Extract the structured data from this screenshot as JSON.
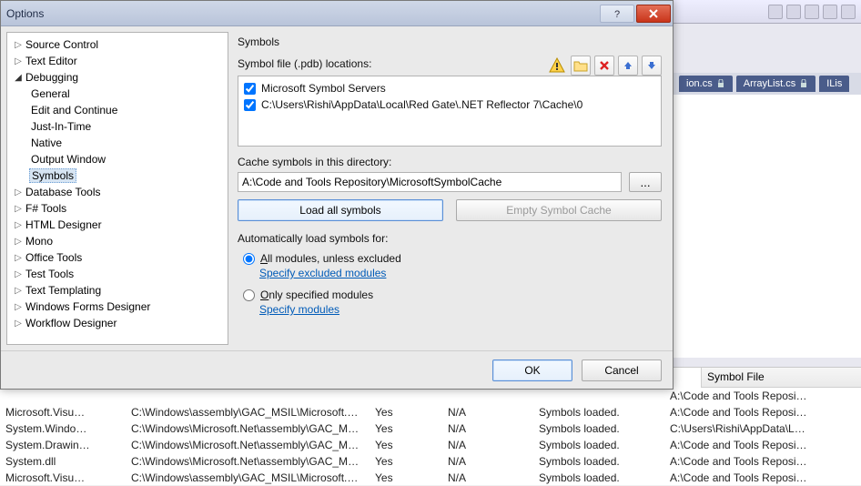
{
  "dialog": {
    "title": "Options",
    "tree": {
      "items": [
        {
          "kind": "node",
          "label": "Source Control",
          "expanded": false
        },
        {
          "kind": "node",
          "label": "Text Editor",
          "expanded": false
        },
        {
          "kind": "node",
          "label": "Debugging",
          "expanded": true
        },
        {
          "kind": "leaf",
          "label": "General"
        },
        {
          "kind": "leaf",
          "label": "Edit and Continue"
        },
        {
          "kind": "leaf",
          "label": "Just-In-Time"
        },
        {
          "kind": "leaf",
          "label": "Native"
        },
        {
          "kind": "leaf",
          "label": "Output Window"
        },
        {
          "kind": "leaf",
          "label": "Symbols",
          "selected": true
        },
        {
          "kind": "node",
          "label": "Database Tools",
          "expanded": false
        },
        {
          "kind": "node",
          "label": "F# Tools",
          "expanded": false
        },
        {
          "kind": "node",
          "label": "HTML Designer",
          "expanded": false
        },
        {
          "kind": "node",
          "label": "Mono",
          "expanded": false
        },
        {
          "kind": "node",
          "label": "Office Tools",
          "expanded": false
        },
        {
          "kind": "node",
          "label": "Test Tools",
          "expanded": false
        },
        {
          "kind": "node",
          "label": "Text Templating",
          "expanded": false
        },
        {
          "kind": "node",
          "label": "Windows Forms Designer",
          "expanded": false
        },
        {
          "kind": "node",
          "label": "Workflow Designer",
          "expanded": false
        }
      ]
    },
    "panel": {
      "heading": "Symbols",
      "locations_label": "Symbol file (.pdb) locations:",
      "locations": [
        {
          "checked": true,
          "text": "Microsoft Symbol Servers"
        },
        {
          "checked": true,
          "text": "C:\\Users\\Rishi\\AppData\\Local\\Red Gate\\.NET Reflector 7\\Cache\\0"
        }
      ],
      "cache_label": "Cache symbols in this directory:",
      "cache_path": "A:\\Code and Tools Repository\\MicrosoftSymbolCache",
      "browse_label": "...",
      "load_all": "Load all symbols",
      "empty_cache": "Empty Symbol Cache",
      "auto_label": "Automatically load symbols for:",
      "radio_all": "All modules, unless excluded",
      "radio_all_link": "Specify excluded modules",
      "radio_only": "Only specified modules",
      "radio_only_link": "Specify modules"
    },
    "footer": {
      "ok": "OK",
      "cancel": "Cancel"
    },
    "icons": {
      "warn": "warning-icon",
      "folder": "folder-open-icon",
      "delete": "delete-icon",
      "up": "arrow-up-icon",
      "down": "arrow-down-icon"
    }
  },
  "ide": {
    "tabs": [
      {
        "label": "ion.cs",
        "locked": true
      },
      {
        "label": "ArrayList.cs",
        "locked": true
      },
      {
        "label": "ILis",
        "locked": false
      }
    ]
  },
  "modules": {
    "header_symbol": "Symbol File",
    "rows": [
      {
        "name": "",
        "path": "",
        "uc": "",
        "opt": "",
        "status": "",
        "sym": "A:\\Code and Tools Reposi…"
      },
      {
        "name": "Microsoft.Visu…",
        "path": "C:\\Windows\\assembly\\GAC_MSIL\\Microsoft.Visual…",
        "uc": "Yes",
        "opt": "N/A",
        "status": "Symbols loaded.",
        "sym": "A:\\Code and Tools Reposi…"
      },
      {
        "name": "System.Windo…",
        "path": "C:\\Windows\\Microsoft.Net\\assembly\\GAC_MSIL\\S…",
        "uc": "Yes",
        "opt": "N/A",
        "status": "Symbols loaded.",
        "sym": "C:\\Users\\Rishi\\AppData\\L…"
      },
      {
        "name": "System.Drawin…",
        "path": "C:\\Windows\\Microsoft.Net\\assembly\\GAC_MSIL\\S…",
        "uc": "Yes",
        "opt": "N/A",
        "status": "Symbols loaded.",
        "sym": "A:\\Code and Tools Reposi…"
      },
      {
        "name": "System.dll",
        "path": "C:\\Windows\\Microsoft.Net\\assembly\\GAC_MSIL\\S…",
        "uc": "Yes",
        "opt": "N/A",
        "status": "Symbols loaded.",
        "sym": "A:\\Code and Tools Reposi…"
      },
      {
        "name": "Microsoft.Visu…",
        "path": "C:\\Windows\\assembly\\GAC_MSIL\\Microsoft.Visual…",
        "uc": "Yes",
        "opt": "N/A",
        "status": "Symbols loaded.",
        "sym": "A:\\Code and Tools Reposi…"
      }
    ]
  }
}
